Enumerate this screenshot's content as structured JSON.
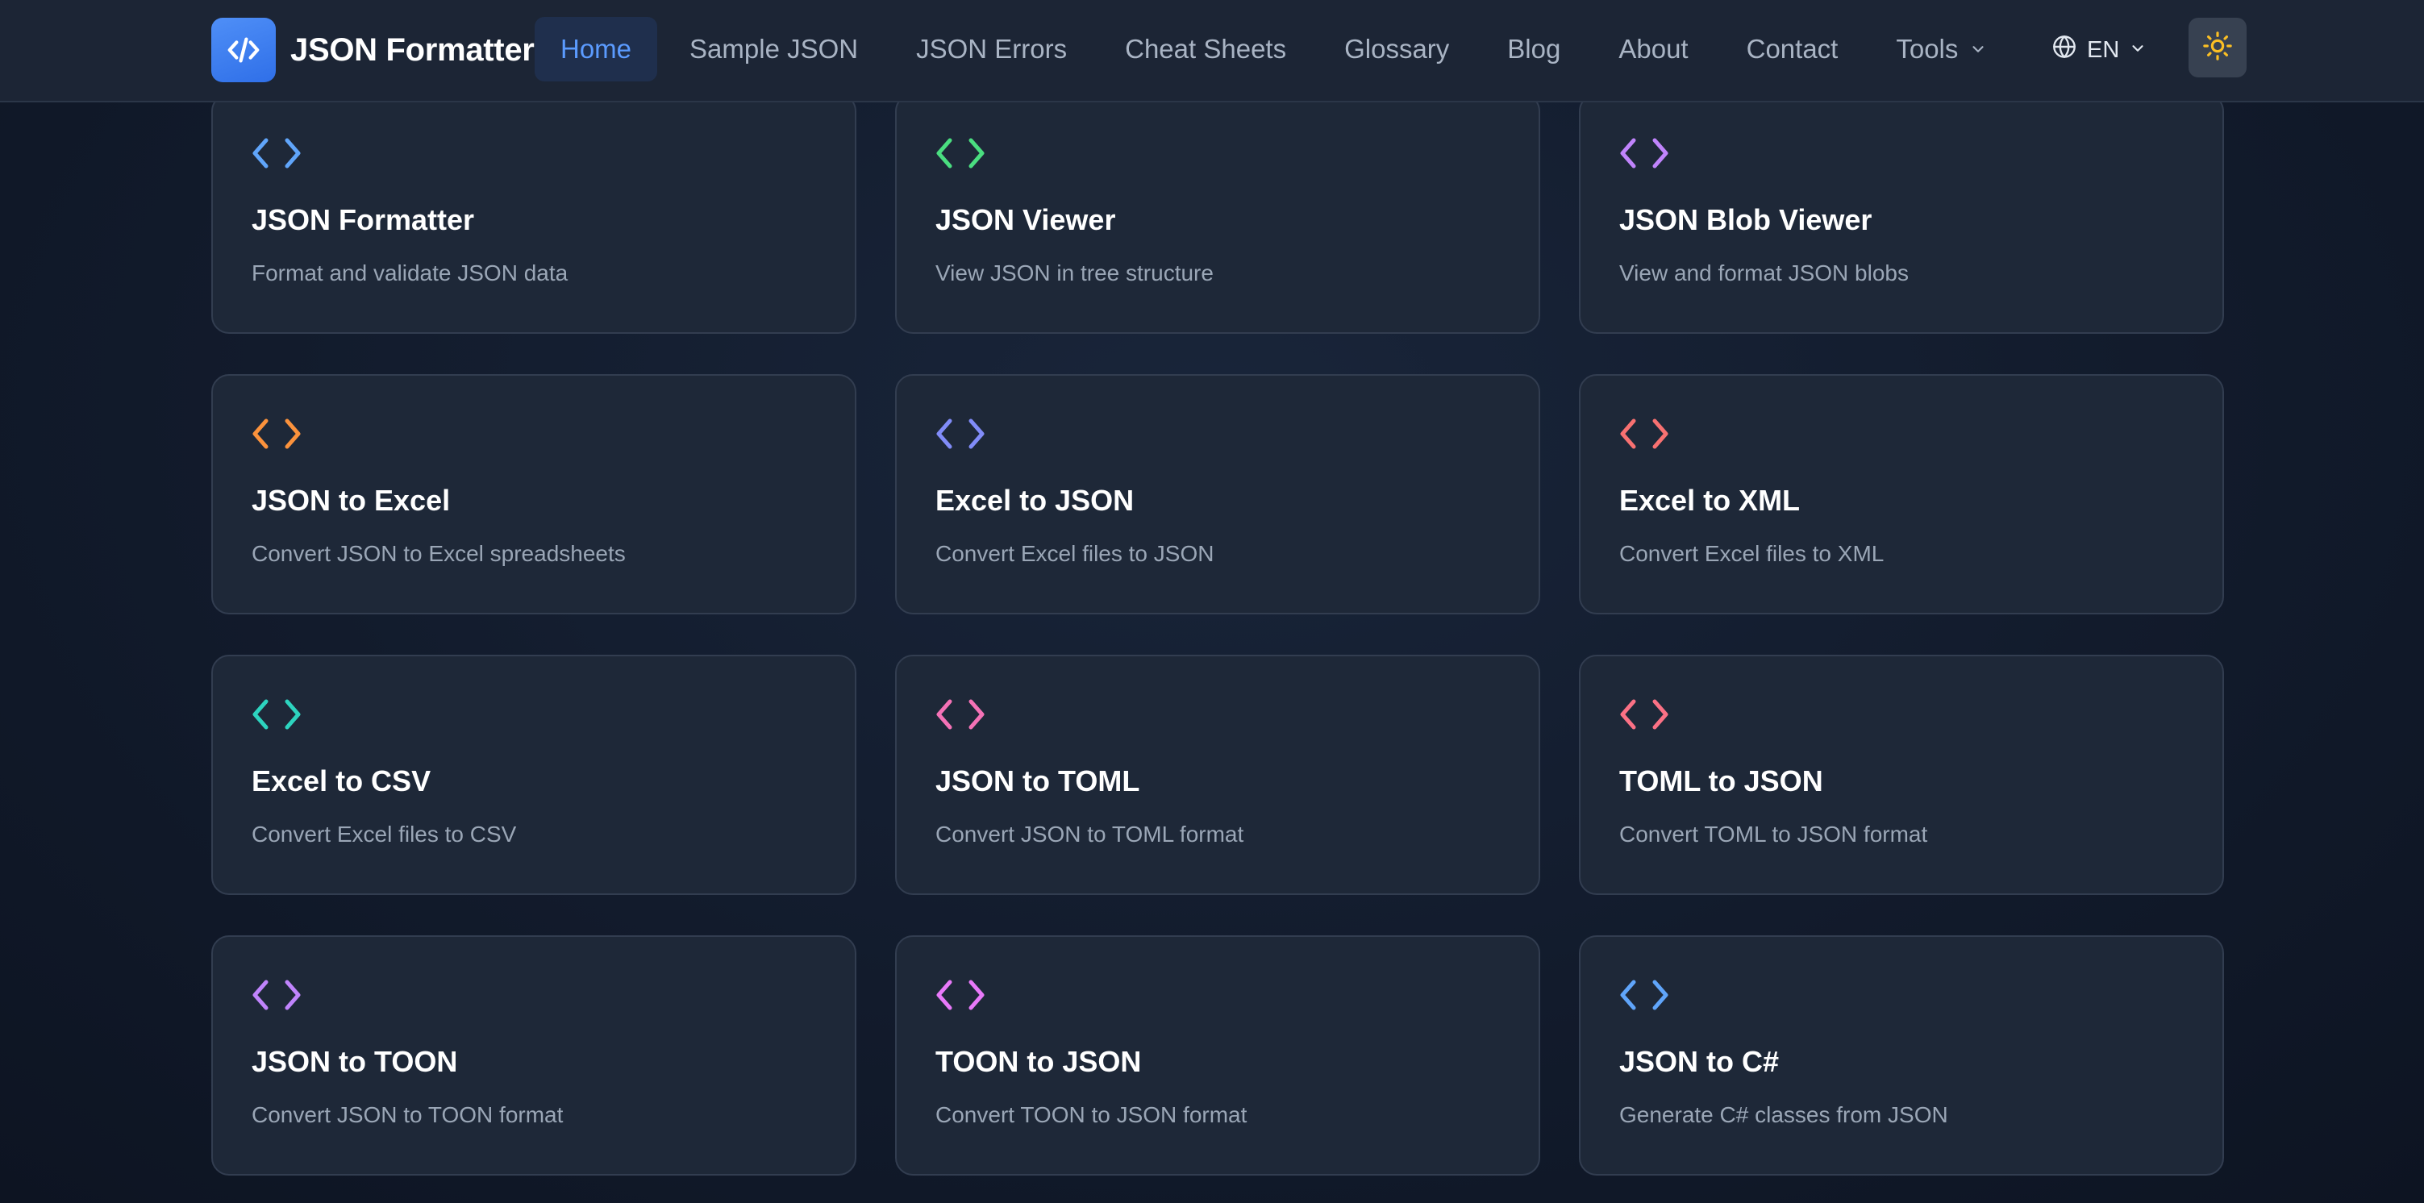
{
  "header": {
    "brand_name": "JSON Formatter",
    "nav": [
      {
        "label": "Home",
        "active": true
      },
      {
        "label": "Sample JSON",
        "active": false
      },
      {
        "label": "JSON Errors",
        "active": false
      },
      {
        "label": "Cheat Sheets",
        "active": false
      },
      {
        "label": "Glossary",
        "active": false
      },
      {
        "label": "Blog",
        "active": false
      },
      {
        "label": "About",
        "active": false
      },
      {
        "label": "Contact",
        "active": false
      },
      {
        "label": "Tools",
        "active": false
      }
    ],
    "language": "EN"
  },
  "icons": {
    "logo": "code-slash-icon",
    "tools_dropdown": "chevron-down-icon",
    "language": "globe-icon",
    "language_dropdown": "chevron-down-icon",
    "theme_toggle": "sun-icon",
    "card": "code-brackets-icon"
  },
  "colors": {
    "accent": "#3b82f6",
    "active_nav_text": "#5b9bff",
    "sun": "#fbbf24"
  },
  "cards": [
    {
      "title": "JSON Formatter",
      "description": "Format and validate JSON data",
      "icon_color": "#60a5fa"
    },
    {
      "title": "JSON Viewer",
      "description": "View JSON in tree structure",
      "icon_color": "#4ade80"
    },
    {
      "title": "JSON Blob Viewer",
      "description": "View and format JSON blobs",
      "icon_color": "#c084fc"
    },
    {
      "title": "JSON to Excel",
      "description": "Convert JSON to Excel spreadsheets",
      "icon_color": "#fb923c"
    },
    {
      "title": "Excel to JSON",
      "description": "Convert Excel files to JSON",
      "icon_color": "#818cf8"
    },
    {
      "title": "Excel to XML",
      "description": "Convert Excel files to XML",
      "icon_color": "#f87171"
    },
    {
      "title": "Excel to CSV",
      "description": "Convert Excel files to CSV",
      "icon_color": "#2dd4bf"
    },
    {
      "title": "JSON to TOML",
      "description": "Convert JSON to TOML format",
      "icon_color": "#f472b6"
    },
    {
      "title": "TOML to JSON",
      "description": "Convert TOML to JSON format",
      "icon_color": "#fb7185"
    },
    {
      "title": "JSON to TOON",
      "description": "Convert JSON to TOON format",
      "icon_color": "#c084fc"
    },
    {
      "title": "TOON to JSON",
      "description": "Convert TOON to JSON format",
      "icon_color": "#e879f9"
    },
    {
      "title": "JSON to C#",
      "description": "Generate C# classes from JSON",
      "icon_color": "#60a5fa"
    }
  ]
}
